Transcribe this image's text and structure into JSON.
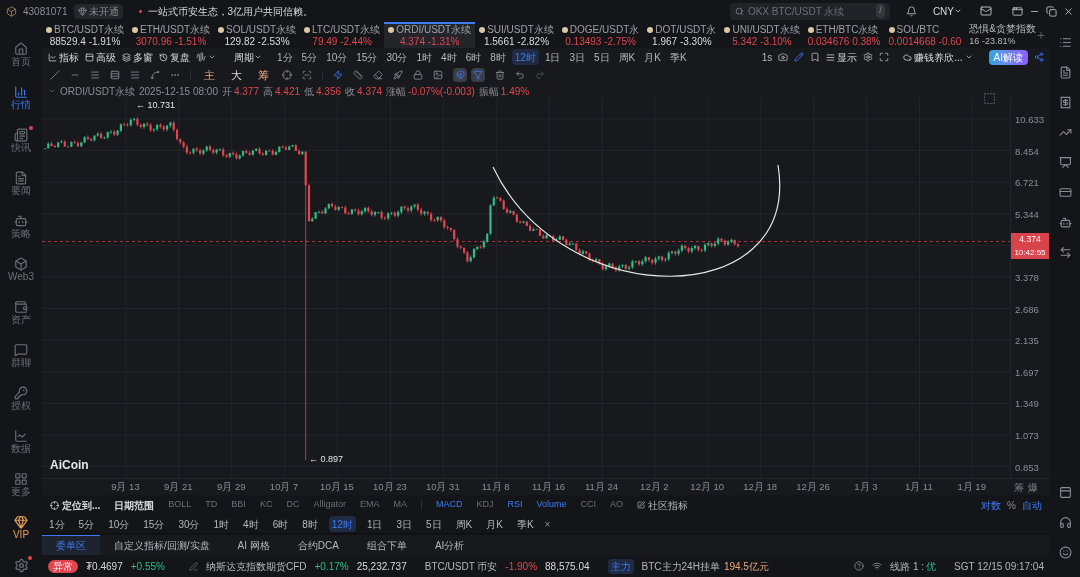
{
  "topbar": {
    "account": "43081071",
    "badge": "未开通",
    "notice": "一站式币安生态，3亿用户共同信赖。",
    "search": {
      "placeholder": "OKX BTC/USDT 永续",
      "shortcut": "/"
    },
    "currency": "CNY"
  },
  "sidebar": {
    "items": [
      {
        "label": "首页",
        "selected": false,
        "dot": false,
        "kind": "normal"
      },
      {
        "label": "行情",
        "selected": true,
        "dot": false,
        "kind": "normal"
      },
      {
        "label": "快讯",
        "selected": false,
        "dot": true,
        "kind": "normal"
      },
      {
        "label": "要闻",
        "selected": false,
        "dot": false,
        "kind": "normal"
      },
      {
        "label": "策略",
        "selected": false,
        "dot": false,
        "kind": "normal"
      },
      {
        "label": "Web3",
        "selected": false,
        "dot": false,
        "kind": "normal"
      },
      {
        "label": "资产",
        "selected": false,
        "dot": false,
        "kind": "normal"
      },
      {
        "label": "群聊",
        "selected": false,
        "dot": false,
        "kind": "normal"
      },
      {
        "label": "授权",
        "selected": false,
        "dot": false,
        "kind": "normal"
      },
      {
        "label": "数据",
        "selected": false,
        "dot": false,
        "kind": "normal"
      },
      {
        "label": "更多",
        "selected": false,
        "dot": false,
        "kind": "normal"
      },
      {
        "label": "VIP",
        "selected": false,
        "dot": false,
        "kind": "vip"
      }
    ],
    "settings_dot": true
  },
  "tickers": [
    {
      "symbol": "BTC/USDT永续",
      "price": "88529.4",
      "change": "-1.91%",
      "falling": false,
      "selected": false
    },
    {
      "symbol": "ETH/USDT永续",
      "price": "3070.96",
      "change": "-1.51%",
      "falling": true,
      "selected": false
    },
    {
      "symbol": "SOL/USDT永续",
      "price": "129.82",
      "change": "-2.53%",
      "falling": false,
      "selected": false
    },
    {
      "symbol": "LTC/USDT永续",
      "price": "79.49",
      "change": "-2.44%",
      "falling": true,
      "selected": false
    },
    {
      "symbol": "ORDI/USDT永续",
      "price": "4.374",
      "change": "-1.31%",
      "falling": true,
      "selected": true
    },
    {
      "symbol": "SUI/USDT永续",
      "price": "1.5661",
      "change": "-2.82%",
      "falling": false,
      "selected": false
    },
    {
      "symbol": "DOGE/USDT永",
      "price": "0.13493",
      "change": "-2.75%",
      "falling": true,
      "selected": false
    },
    {
      "symbol": "DOT/USDT永",
      "price": "1.967",
      "change": "-3.30%",
      "falling": false,
      "selected": false
    },
    {
      "symbol": "UNI/USDT永续",
      "price": "5.342",
      "change": "-3.10%",
      "falling": true,
      "selected": false
    },
    {
      "symbol": "ETH/BTC永续",
      "price": "0.034676",
      "change": "0.38%",
      "falling": true,
      "selected": false
    },
    {
      "symbol": "SOL/BTC",
      "price": "0.0014668",
      "change": "-0.60",
      "falling": true,
      "selected": false
    }
  ],
  "fear_greed": {
    "title": "恐惧&贪婪指数",
    "value": "16",
    "change": "-23.81%"
  },
  "toolbar": {
    "tools": [
      "指标",
      "高级",
      "多窗",
      "复盘"
    ],
    "period_label": "周期",
    "periods": [
      {
        "label": "1分",
        "selected": false
      },
      {
        "label": "5分",
        "selected": false
      },
      {
        "label": "10分",
        "selected": false
      },
      {
        "label": "15分",
        "selected": false
      },
      {
        "label": "30分",
        "selected": false
      },
      {
        "label": "1时",
        "selected": false
      },
      {
        "label": "4时",
        "selected": false
      },
      {
        "label": "6时",
        "selected": false
      },
      {
        "label": "8时",
        "selected": false
      },
      {
        "label": "12时",
        "selected": true
      },
      {
        "label": "1日",
        "selected": false
      },
      {
        "label": "3日",
        "selected": false
      },
      {
        "label": "5日",
        "selected": false
      },
      {
        "label": "周K",
        "selected": false
      },
      {
        "label": "月K",
        "selected": false
      },
      {
        "label": "季K",
        "selected": false
      }
    ],
    "interval": "1s",
    "display": "显示",
    "strategy": "赚钱养欣...",
    "ai": "AI解读"
  },
  "drawing_tools": {
    "chars": [
      "主",
      "大",
      "筹"
    ],
    "snap_on": true,
    "filter_on": true
  },
  "info": {
    "symbol": "ORDI/USDT永续",
    "time": "2025-12-15 08:00",
    "fields": [
      {
        "label": "开",
        "value": "4.377"
      },
      {
        "label": "高",
        "value": "4.421"
      },
      {
        "label": "低",
        "value": "4.356"
      },
      {
        "label": "收",
        "value": "4.374"
      },
      {
        "label": "涨幅",
        "value": "-0.07%(-0.003)"
      },
      {
        "label": "振幅",
        "value": "1.49%"
      }
    ]
  },
  "chart": {
    "high_label": "← 10.731",
    "low_label": "← 0.897",
    "logo": "AiCoin",
    "last_price": "4.374",
    "countdown": "10:42:55",
    "price_ticks": [
      "10.633",
      "8.454",
      "6.721",
      "5.344",
      "3.378",
      "2.686",
      "2.135",
      "1.697",
      "1.349",
      "1.073",
      "0.853"
    ],
    "date_ticks": [
      "9月 13",
      "9月 21",
      "9月 29",
      "10月 7",
      "10月 15",
      "10月 23",
      "10月 31",
      "11月 8",
      "11月 16",
      "11月 24",
      "12月 2",
      "12月 10",
      "12月 18",
      "12月 26",
      "1月 3",
      "1月 11",
      "1月 19"
    ],
    "corner": [
      "筹",
      "爆"
    ]
  },
  "indicators": {
    "locate": "定位到...",
    "date_range": "日期范围",
    "main": [
      {
        "label": "BOLL",
        "selected": false
      },
      {
        "label": "TD",
        "selected": false
      },
      {
        "label": "BBI",
        "selected": false
      },
      {
        "label": "KC",
        "selected": false
      },
      {
        "label": "DC",
        "selected": false
      },
      {
        "label": "Alligator",
        "selected": false
      },
      {
        "label": "EMA",
        "selected": false
      },
      {
        "label": "MA",
        "selected": false
      }
    ],
    "sub": [
      {
        "label": "MACD",
        "selected": true
      },
      {
        "label": "KDJ",
        "selected": false
      },
      {
        "label": "RSI",
        "selected": true
      },
      {
        "label": "Volume",
        "selected": true
      },
      {
        "label": "CCI",
        "selected": false
      },
      {
        "label": "AO",
        "selected": false
      }
    ],
    "community": "社区指标",
    "scale": [
      {
        "label": "对数",
        "selected": true
      },
      {
        "label": "%",
        "selected": false
      },
      {
        "label": "自动",
        "selected": true
      }
    ]
  },
  "quick_periods": {
    "items": [
      {
        "label": "1分",
        "selected": false
      },
      {
        "label": "5分",
        "selected": false
      },
      {
        "label": "10分",
        "selected": false
      },
      {
        "label": "15分",
        "selected": false
      },
      {
        "label": "30分",
        "selected": false
      },
      {
        "label": "1时",
        "selected": false
      },
      {
        "label": "4时",
        "selected": false
      },
      {
        "label": "6时",
        "selected": false
      },
      {
        "label": "8时",
        "selected": false
      },
      {
        "label": "12时",
        "selected": true
      },
      {
        "label": "1日",
        "selected": false
      },
      {
        "label": "3日",
        "selected": false
      },
      {
        "label": "5日",
        "selected": false
      },
      {
        "label": "周K",
        "selected": false
      },
      {
        "label": "月K",
        "selected": false
      },
      {
        "label": "季K",
        "selected": false
      }
    ],
    "close": "×"
  },
  "bottom_tabs": [
    {
      "label": "委单区",
      "selected": true
    },
    {
      "label": "自定义指标/回测/实盘",
      "selected": false
    },
    {
      "label": "AI 网格",
      "selected": false
    },
    {
      "label": "合约DCA",
      "selected": false
    },
    {
      "label": "组合下单",
      "selected": false
    },
    {
      "label": "AI分析",
      "selected": false
    }
  ],
  "status_bar": {
    "alert": "异常",
    "usdt_price": "₮0.4697",
    "usdt_change": "+0.55%",
    "markets": [
      {
        "name": "纳斯达克指数期货CFD",
        "change": "+0.17%",
        "value": "25,232.737",
        "rising": true
      },
      {
        "name": "BTC/USDT 币安",
        "change": "-1.90%",
        "value": "88,575.04",
        "rising": false
      }
    ],
    "main_badge": "主力",
    "main_text": "BTC主力24H挂单",
    "main_value": "194.5亿元",
    "line": "线路 1 :",
    "line_quality": "优",
    "clock": "SGT 12/15 09:17:04"
  }
}
